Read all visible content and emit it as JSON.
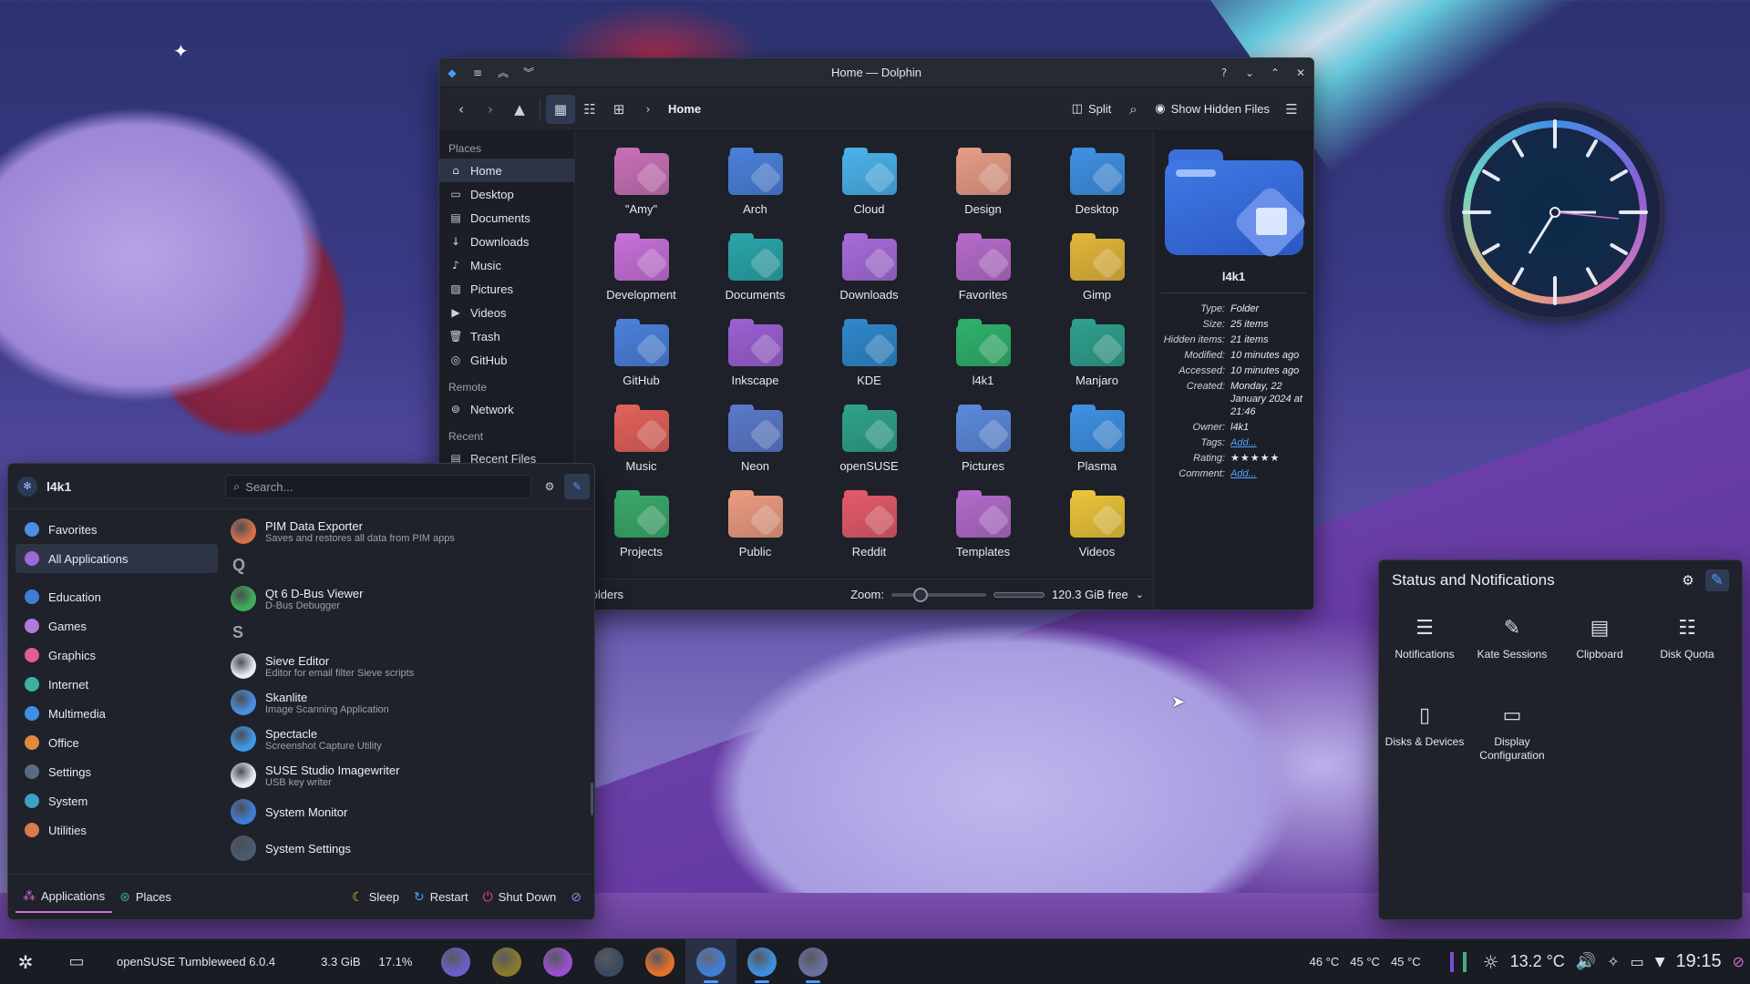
{
  "colors": {
    "accent": "#4a9cff",
    "panel": "#1f222a",
    "selection": "#2d3446",
    "pink": "#d76bd9"
  },
  "dolphin": {
    "title": "Home — Dolphin",
    "breadcrumb": "Home",
    "toolbar": {
      "split": "Split",
      "show_hidden": "Show Hidden Files"
    },
    "places": {
      "header_places": "Places",
      "items": [
        "Home",
        "Desktop",
        "Documents",
        "Downloads",
        "Music",
        "Pictures",
        "Videos",
        "Trash",
        "GitHub"
      ],
      "header_remote": "Remote",
      "remote": [
        "Network"
      ],
      "header_recent": "Recent",
      "recent": [
        "Recent Files"
      ]
    },
    "folders": [
      {
        "name": "\"Amy\"",
        "color": "#c66fb4"
      },
      {
        "name": "Arch",
        "color": "#4a7fd8"
      },
      {
        "name": "Cloud",
        "color": "#4ab0e8"
      },
      {
        "name": "Design",
        "color": "#e39a86"
      },
      {
        "name": "Desktop",
        "color": "#3f8fe0"
      },
      {
        "name": "Development",
        "color": "#c46fd6"
      },
      {
        "name": "Documents",
        "color": "#2aa3a8"
      },
      {
        "name": "Downloads",
        "color": "#a56ad8"
      },
      {
        "name": "Favorites",
        "color": "#b36ac8"
      },
      {
        "name": "Gimp",
        "color": "#e0b43a"
      },
      {
        "name": "GitHub",
        "color": "#4a7fd8"
      },
      {
        "name": "Inkscape",
        "color": "#9a5fd0"
      },
      {
        "name": "KDE",
        "color": "#2f86c8"
      },
      {
        "name": "l4k1",
        "color": "#2fb06a"
      },
      {
        "name": "Manjaro",
        "color": "#2f9e8c"
      },
      {
        "name": "Music",
        "color": "#e0605a"
      },
      {
        "name": "Neon",
        "color": "#5a78c8"
      },
      {
        "name": "openSUSE",
        "color": "#2fa08a"
      },
      {
        "name": "Pictures",
        "color": "#5a88d8"
      },
      {
        "name": "Plasma",
        "color": "#3f8fe0"
      },
      {
        "name": "Projects",
        "color": "#3aa86a"
      },
      {
        "name": "Public",
        "color": "#e89a80"
      },
      {
        "name": "Reddit",
        "color": "#e05a6a"
      },
      {
        "name": "Templates",
        "color": "#b06ac8"
      },
      {
        "name": "Videos",
        "color": "#e8c23a"
      }
    ],
    "status": {
      "text": "folders",
      "zoom_label": "Zoom:",
      "free": "120.3 GiB free"
    },
    "info": {
      "name": "l4k1",
      "rows": [
        {
          "k": "Type:",
          "v": "Folder"
        },
        {
          "k": "Size:",
          "v": "25 items"
        },
        {
          "k": "Hidden items:",
          "v": "21 items"
        },
        {
          "k": "Modified:",
          "v": "10 minutes ago"
        },
        {
          "k": "Accessed:",
          "v": "10 minutes ago"
        },
        {
          "k": "Created:",
          "v": "Monday, 22 January 2024 at 21:46"
        },
        {
          "k": "Owner:",
          "v": "l4k1"
        },
        {
          "k": "Tags:",
          "v": "Add..."
        },
        {
          "k": "Rating:",
          "v": "★★★★★"
        },
        {
          "k": "Comment:",
          "v": "Add..."
        }
      ]
    }
  },
  "launcher": {
    "user": "l4k1",
    "search_placeholder": "Search...",
    "categories": [
      "Favorites",
      "All Applications",
      "Education",
      "Games",
      "Graphics",
      "Internet",
      "Multimedia",
      "Office",
      "Settings",
      "System",
      "Utilities"
    ],
    "apps": [
      {
        "name": "PIM Data Exporter",
        "desc": "Saves and restores all data from PIM apps",
        "color": "#d8704a"
      },
      {
        "letter": "Q"
      },
      {
        "name": "Qt 6 D-Bus Viewer",
        "desc": "D-Bus Debugger",
        "color": "#3fae5a"
      },
      {
        "letter": "S"
      },
      {
        "name": "Sieve Editor",
        "desc": "Editor for email filter Sieve scripts",
        "color": "#e8eaf2"
      },
      {
        "name": "Skanlite",
        "desc": "Image Scanning Application",
        "color": "#4a8fe0"
      },
      {
        "name": "Spectacle",
        "desc": "Screenshot Capture Utility",
        "color": "#3f9ae8"
      },
      {
        "name": "SUSE Studio Imagewriter",
        "desc": "USB key writer",
        "color": "#e8eaf2"
      },
      {
        "name": "System Monitor",
        "desc": "",
        "color": "#3f7ed8"
      },
      {
        "name": "System Settings",
        "desc": "",
        "color": "#4a5a70"
      }
    ],
    "footer": {
      "applications": "Applications",
      "places": "Places",
      "sleep": "Sleep",
      "restart": "Restart",
      "shutdown": "Shut Down"
    }
  },
  "notifications": {
    "title": "Status and Notifications",
    "items": [
      {
        "label": "Notifications",
        "icon": "notifications-icon",
        "glyph": "☰"
      },
      {
        "label": "Kate Sessions",
        "icon": "kate-icon",
        "glyph": "✎"
      },
      {
        "label": "Clipboard",
        "icon": "clipboard-icon",
        "glyph": "▤"
      },
      {
        "label": "Disk Quota",
        "icon": "disk-quota-icon",
        "glyph": "☷"
      },
      {
        "label": "Disks & Devices",
        "icon": "disks-icon",
        "glyph": "▯"
      },
      {
        "label": "Display Configuration",
        "icon": "display-icon",
        "glyph": "▭"
      }
    ]
  },
  "taskbar": {
    "distro": "openSUSE Tumbleweed 6.0.4",
    "ram": "3.3 GiB",
    "cpu": "17.1%",
    "temps": [
      "46 °C",
      "45 °C",
      "45 °C"
    ],
    "weather": "13.2 °C",
    "time": "19:15",
    "apps": [
      {
        "name": "app-1",
        "color": "#6a5fc8"
      },
      {
        "name": "app-2",
        "color": "#8a7a2a"
      },
      {
        "name": "app-3",
        "color": "#9a4fd0"
      },
      {
        "name": "app-4",
        "color": "#3a4a60"
      },
      {
        "name": "firefox",
        "color": "#e8702a"
      },
      {
        "name": "dolphin",
        "color": "#3f7ed8"
      },
      {
        "name": "app-7",
        "color": "#3f8fe0"
      },
      {
        "name": "app-8",
        "color": "#6a70a0"
      }
    ]
  }
}
